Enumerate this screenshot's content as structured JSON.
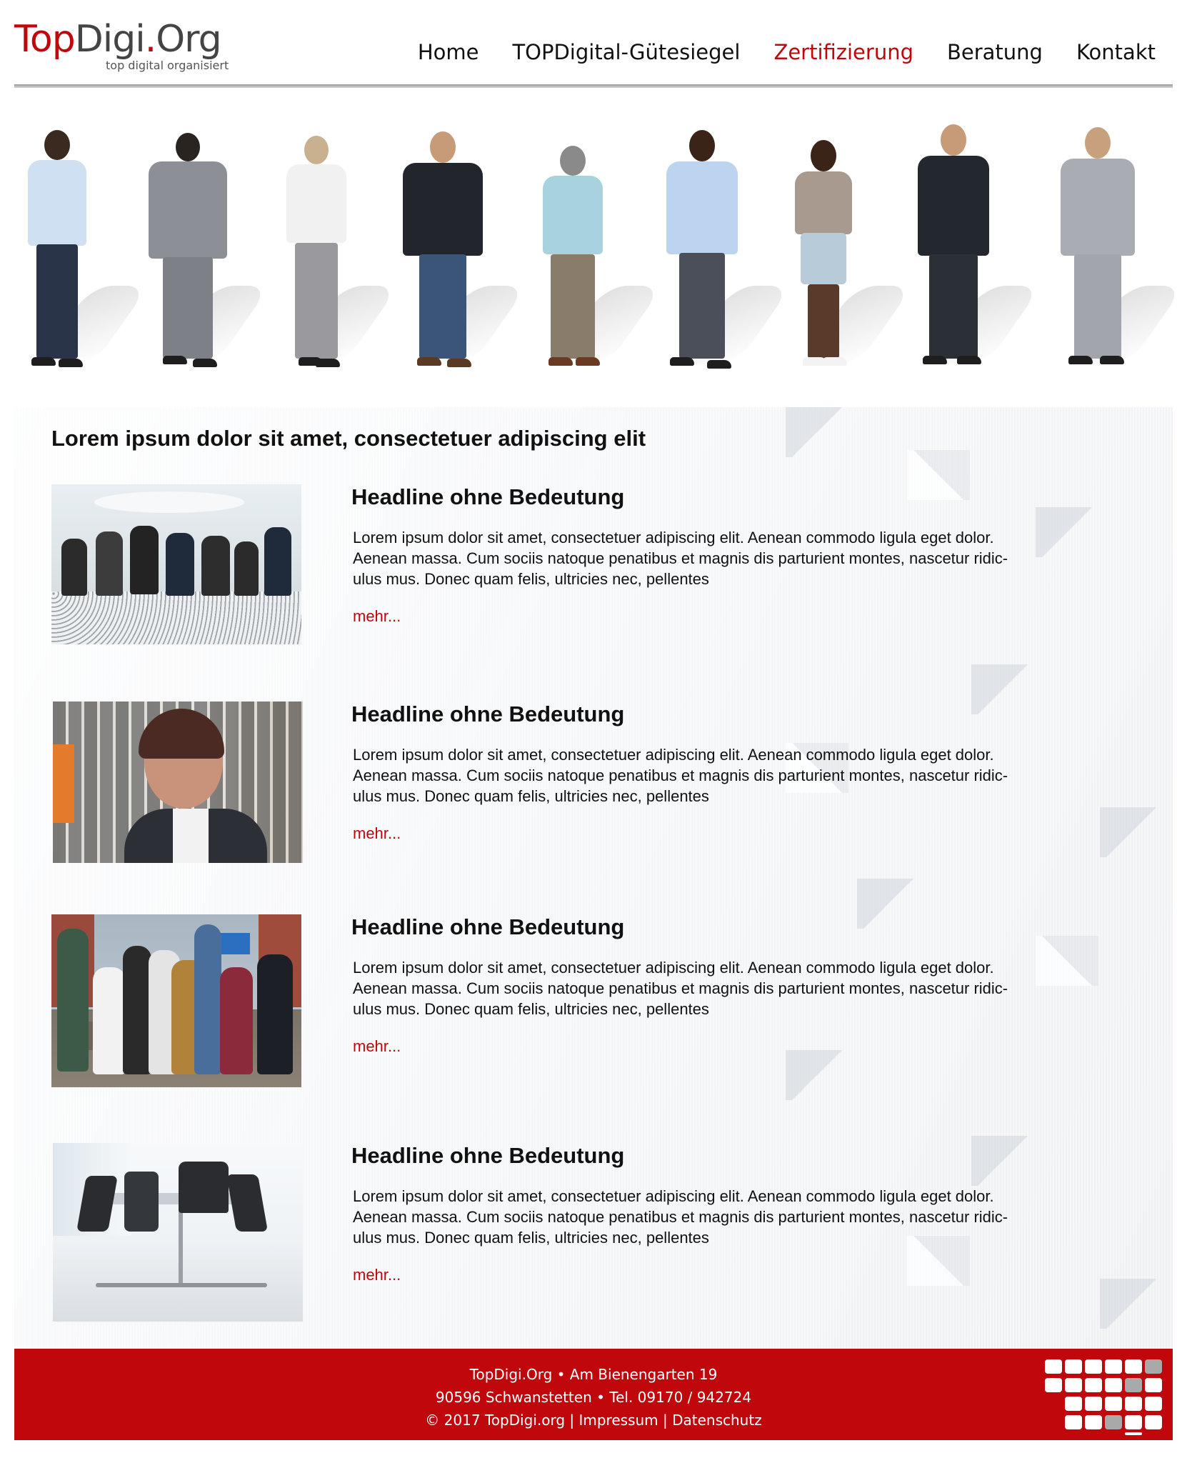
{
  "header": {
    "logo_top": "Top",
    "logo_digi": "Digi",
    "logo_dot": ".",
    "logo_org": "Org",
    "logo_tagline": "top digital organisiert",
    "nav": [
      {
        "label": "Home",
        "active": false
      },
      {
        "label": "TOPDigital-Gütesiegel",
        "active": false
      },
      {
        "label": "Zertifizierung",
        "active": true
      },
      {
        "label": "Beratung",
        "active": false
      },
      {
        "label": "Kontakt",
        "active": false
      }
    ]
  },
  "colors": {
    "brand_red": "#c0070c",
    "text": "#111111",
    "background_grey": "#f3f4f6"
  },
  "main": {
    "intro": "Lorem ipsum dolor sit amet, consectetuer adipiscing elit",
    "articles": [
      {
        "title": "Headline ohne Bedeutung",
        "line1": "Lorem ipsum dolor sit amet, consectetuer adipiscing elit. Aenean commodo ligula eget dolor.",
        "line2": "Aenean massa. Cum sociis natoque penatibus et magnis dis parturient montes, nascetur ridic-",
        "line3": "ulus mus. Donec quam felis, ultricies nec, pellentes",
        "more": "mehr..."
      },
      {
        "title": "Headline ohne Bedeutung",
        "line1": "Lorem ipsum dolor sit amet, consectetuer adipiscing elit. Aenean commodo ligula eget dolor.",
        "line2": "Aenean massa. Cum sociis natoque penatibus et magnis dis parturient montes, nascetur ridic-",
        "line3": "ulus mus. Donec quam felis, ultricies nec, pellentes",
        "more": "mehr..."
      },
      {
        "title": "Headline ohne Bedeutung",
        "line1": "Lorem ipsum dolor sit amet, consectetuer adipiscing elit. Aenean commodo ligula eget dolor.",
        "line2": "Aenean massa. Cum sociis natoque penatibus et magnis dis parturient montes, nascetur ridic-",
        "line3": "ulus mus. Donec quam felis, ultricies nec, pellentes",
        "more": "mehr..."
      },
      {
        "title": "Headline ohne Bedeutung",
        "line1": "Lorem ipsum dolor sit amet, consectetuer adipiscing elit. Aenean commodo ligula eget dolor.",
        "line2": "Aenean massa. Cum sociis natoque penatibus et magnis dis parturient montes, nascetur ridic-",
        "line3": "ulus mus. Donec quam felis, ultricies nec, pellentes",
        "more": "mehr..."
      }
    ]
  },
  "footer": {
    "line1": "TopDigi.Org • Am Bienengarten 19",
    "line2": "90596 Schwanstetten • Tel. 09170 / 942724",
    "copyright": "© 2017 TopDigi.org",
    "separator": " | ",
    "impressum": "Impressum",
    "datenschutz": "Datenschutz"
  }
}
